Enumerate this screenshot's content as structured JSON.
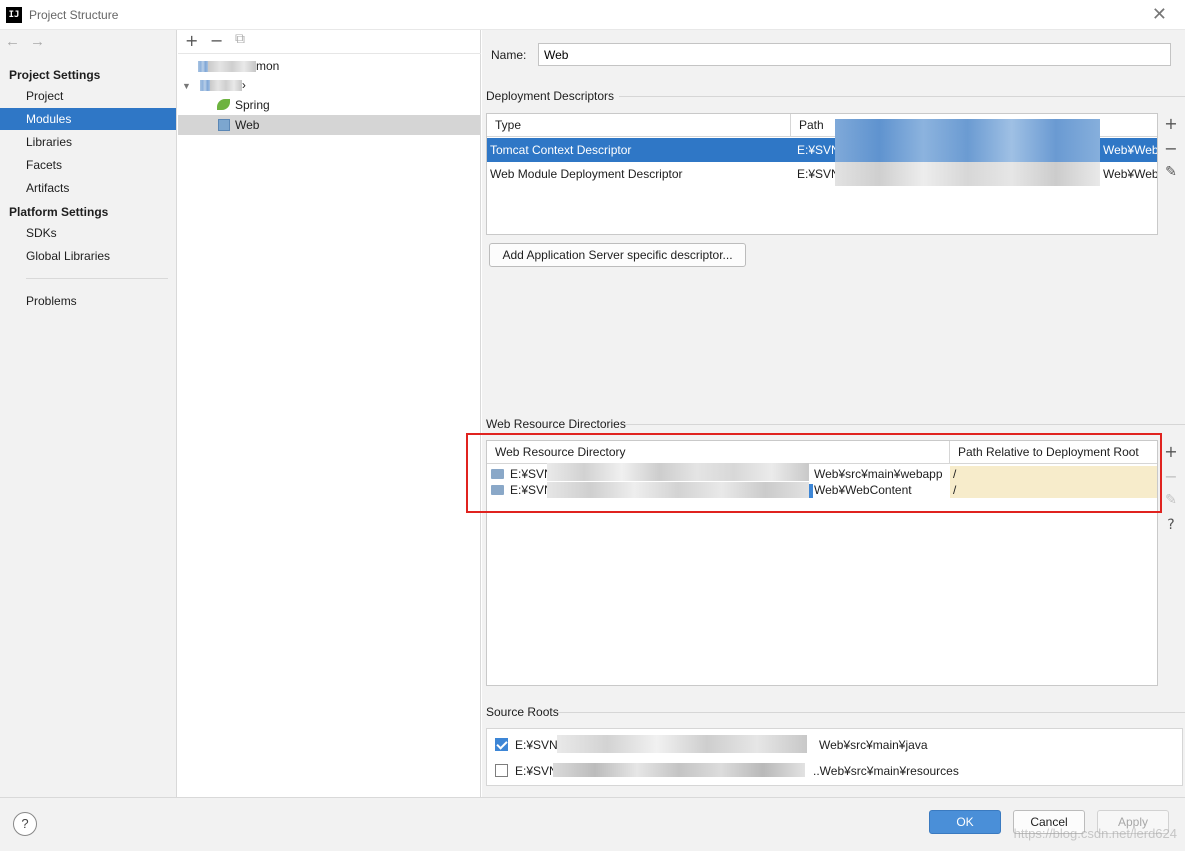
{
  "window": {
    "title": "Project Structure",
    "app_icon": "IJ",
    "close_glyph": "✕"
  },
  "nav": {
    "back_glyph": "←",
    "forward_glyph": "→",
    "project_settings_label": "Project Settings",
    "project_settings_items": [
      "Project",
      "Modules",
      "Libraries",
      "Facets",
      "Artifacts"
    ],
    "selected_item": "Modules",
    "platform_settings_label": "Platform Settings",
    "platform_settings_items": [
      "SDKs",
      "Global Libraries"
    ],
    "problems_label": "Problems"
  },
  "tree": {
    "toolbar": {
      "add": "+",
      "remove": "−",
      "copy": "⧉"
    },
    "row1_suffix": "mon",
    "row2_suffix": "›",
    "spring_label": "Spring",
    "web_label": "Web",
    "expand_glyph": "▼"
  },
  "details": {
    "name_label": "Name:",
    "name_value": "Web",
    "deployment_descriptors_title": "Deployment Descriptors",
    "dd_columns": [
      "Type",
      "Path"
    ],
    "dd_rows": [
      {
        "type": "Tomcat Context Descriptor",
        "path_start": "E:¥SVN¥",
        "path_end": "Web¥WebC"
      },
      {
        "type": "Web Module Deployment Descriptor",
        "path_start": "E:¥SVN¥",
        "path_end": "Web¥WebC"
      }
    ],
    "add_server_descriptor_button": "Add Application Server specific descriptor...",
    "web_resource_title": "Web Resource Directories",
    "wr_columns": [
      "Web Resource Directory",
      "Path Relative to Deployment Root"
    ],
    "wr_rows": [
      {
        "dir_start": "E:¥SVN¥",
        "dir_end": "Web¥src¥main¥webapp",
        "relative": "/"
      },
      {
        "dir_start": "E:¥SVN",
        "dir_end": "Web¥WebContent",
        "relative": "/"
      }
    ],
    "source_roots_title": "Source Roots",
    "source_roots": [
      {
        "path_start": "E:¥SVN¥",
        "path_end": "Web¥src¥main¥java",
        "checked": true
      },
      {
        "path_start": "E:¥SVN¥",
        "path_end": "..Web¥src¥main¥resources",
        "checked": false
      }
    ],
    "side_tools": {
      "add": "+",
      "remove": "−",
      "edit": "✎",
      "help": "?"
    }
  },
  "footer": {
    "help_label": "?",
    "ok_label": "OK",
    "cancel_label": "Cancel",
    "apply_label": "Apply",
    "watermark": "https://blog.csdn.net/lerd624"
  },
  "colors": {
    "selection": "#2f77c6",
    "highlight_border": "#e0231f",
    "relative_path_bg": "#f7eccb"
  }
}
